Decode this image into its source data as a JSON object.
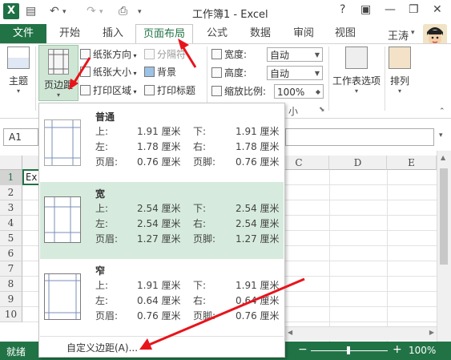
{
  "titlebar": {
    "app_icon": "X",
    "title": "工作簿1 - Excel",
    "help": "?",
    "minimize": "—",
    "restore": "❐",
    "close": "✕"
  },
  "tabs": {
    "file": "文件",
    "items": [
      "开始",
      "插入",
      "页面布局",
      "公式",
      "数据",
      "审阅",
      "视图"
    ],
    "active": "页面布局",
    "user": "王涛"
  },
  "ribbon": {
    "themes": "主题",
    "margins": "页边距",
    "orientation": "纸张方向",
    "size": "纸张大小",
    "print_area": "打印区域",
    "breaks": "分隔符",
    "background": "背景",
    "print_titles": "打印标题",
    "width_label": "宽度:",
    "width_value": "自动",
    "height_label": "高度:",
    "height_value": "自动",
    "scale_label": "缩放比例:",
    "scale_value": "100%",
    "scale_group_tail": "小",
    "sheet_options": "工作表选项",
    "arrange": "排列"
  },
  "namebox": "A1",
  "sheet": {
    "columns": [
      "C",
      "D",
      "E"
    ],
    "rows": [
      "1",
      "2",
      "3",
      "4",
      "5",
      "6",
      "7",
      "8",
      "9",
      "10"
    ],
    "cell_a1": "Ex"
  },
  "margins_menu": {
    "options": [
      {
        "name": "普通",
        "top_label": "上:",
        "top": "1.91 厘米",
        "bottom_label": "下:",
        "bottom": "1.91 厘米",
        "left_label": "左:",
        "left": "1.78 厘米",
        "right_label": "右:",
        "right": "1.78 厘米",
        "header_label": "页眉:",
        "header": "0.76 厘米",
        "footer_label": "页脚:",
        "footer": "0.76 厘米"
      },
      {
        "name": "宽",
        "top_label": "上:",
        "top": "2.54 厘米",
        "bottom_label": "下:",
        "bottom": "2.54 厘米",
        "left_label": "左:",
        "left": "2.54 厘米",
        "right_label": "右:",
        "right": "2.54 厘米",
        "header_label": "页眉:",
        "header": "1.27 厘米",
        "footer_label": "页脚:",
        "footer": "1.27 厘米"
      },
      {
        "name": "窄",
        "top_label": "上:",
        "top": "1.91 厘米",
        "bottom_label": "下:",
        "bottom": "1.91 厘米",
        "left_label": "左:",
        "left": "0.64 厘米",
        "right_label": "右:",
        "right": "0.64 厘米",
        "header_label": "页眉:",
        "header": "0.76 厘米",
        "footer_label": "页脚:",
        "footer": "0.76 厘米"
      }
    ],
    "highlighted": "宽",
    "custom": "自定义边距(A)..."
  },
  "statusbar": {
    "status": "就绪",
    "zoom_out": "−",
    "zoom_in": "+",
    "zoom": "100%"
  },
  "colors": {
    "excel_green": "#217346",
    "highlight": "#d6ebdd",
    "arrow_red": "#e8141c"
  }
}
